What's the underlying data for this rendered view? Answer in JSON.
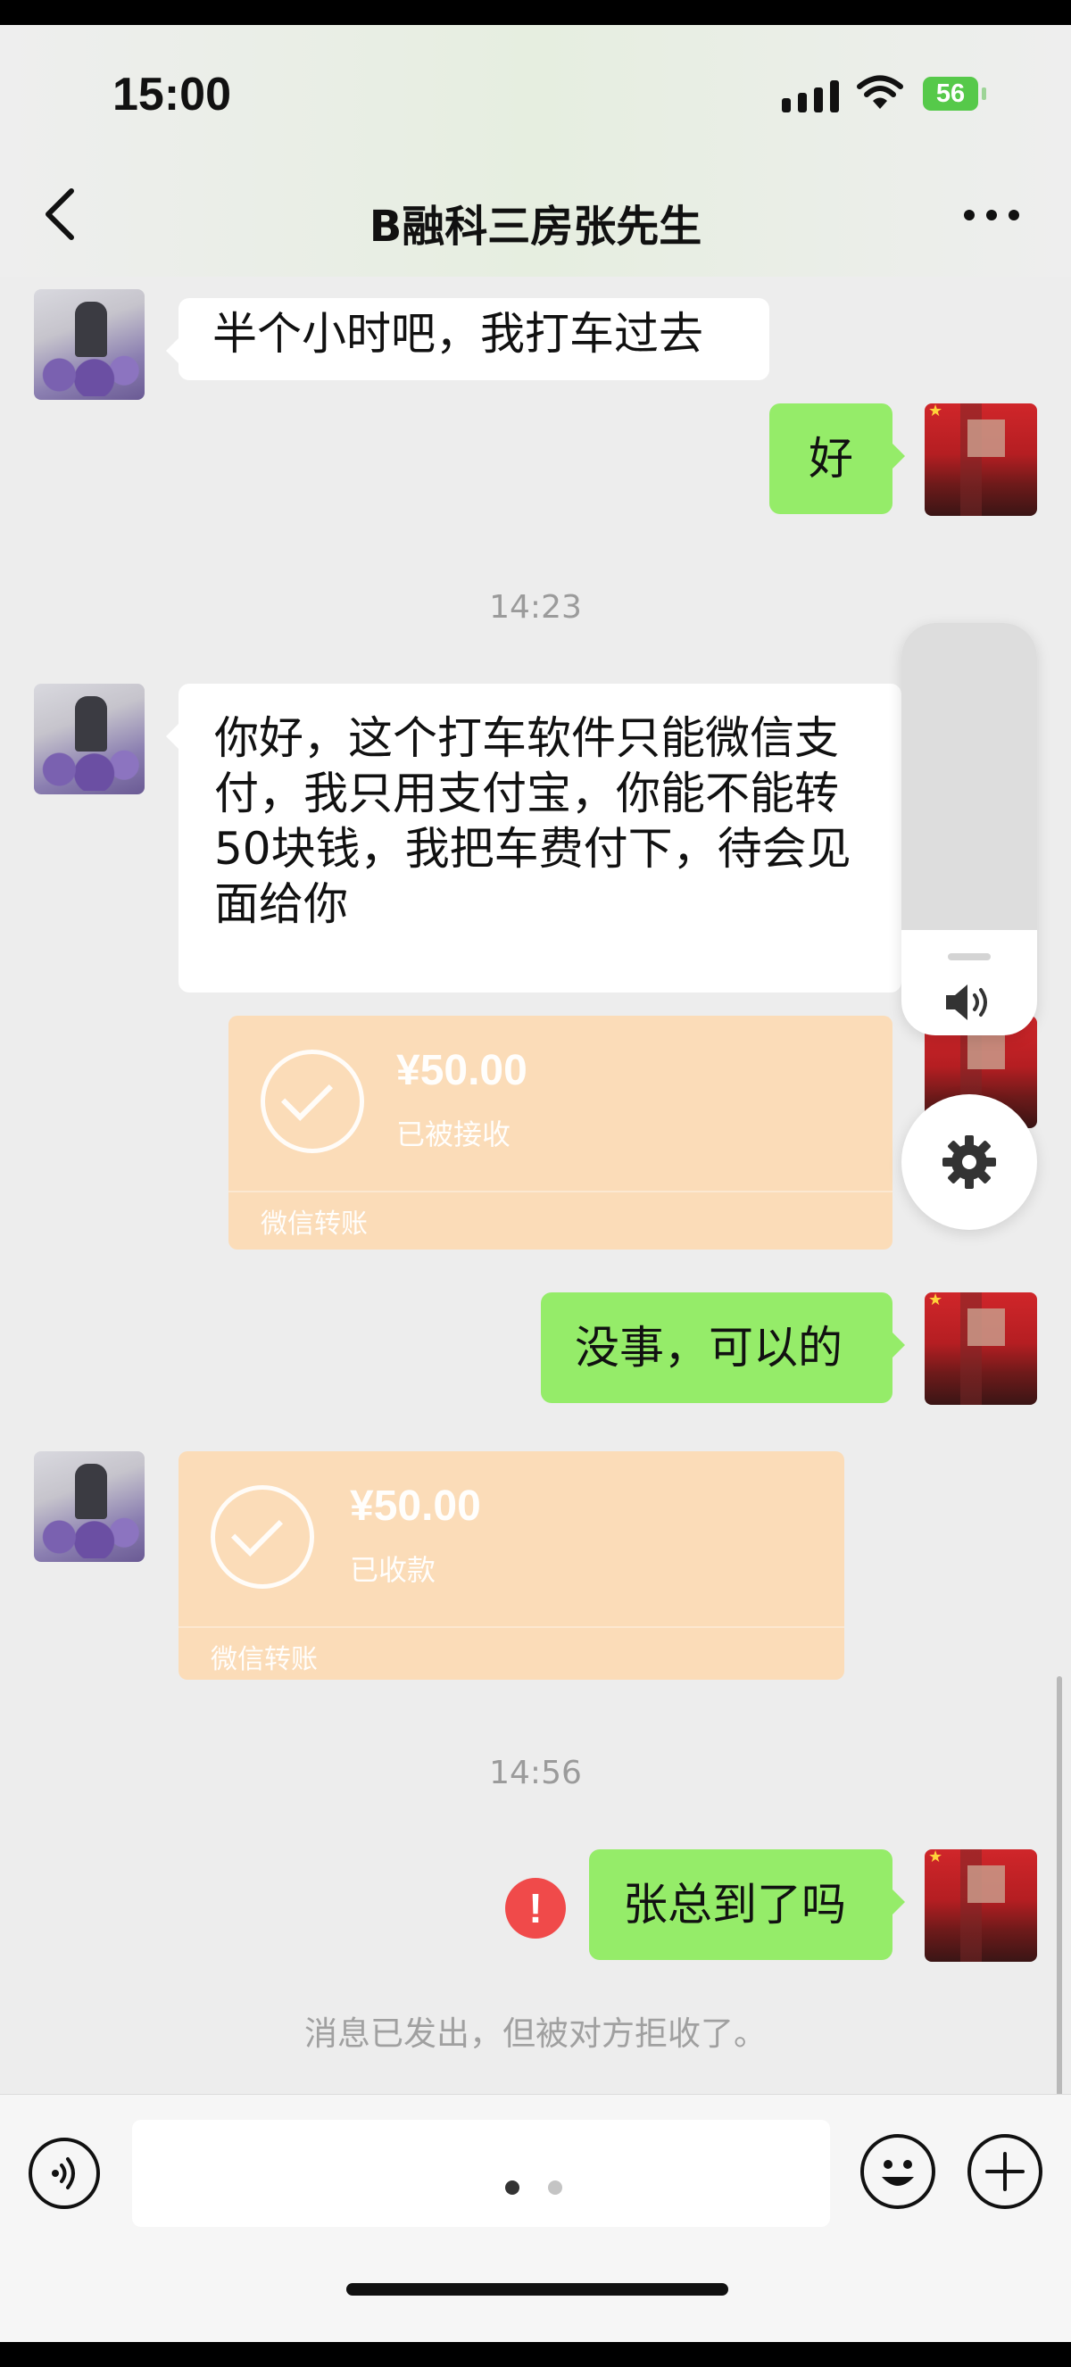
{
  "status_bar": {
    "time": "15:00",
    "battery": "56"
  },
  "header": {
    "title": "B融科三房张先生"
  },
  "messages": {
    "m1": {
      "text": "半个小时吧，我打车过去"
    },
    "m2": {
      "text": "好"
    },
    "ts1": "14:23",
    "m3": {
      "lines": [
        "你好，这个打车软件只能微信支",
        "付，我只用支付宝，你能不能转",
        "50块钱，我把车费付下，待会见",
        "面给你"
      ]
    },
    "transfer1": {
      "amount": "¥50.00",
      "status": "已被接收",
      "footer": "微信转账"
    },
    "m4": {
      "text": "没事，可以的"
    },
    "transfer2": {
      "amount": "¥50.00",
      "status": "已收款",
      "footer": "微信转账"
    },
    "ts2": "14:56",
    "m5": {
      "text": "张总到了吗"
    },
    "error_mark": "!",
    "reject_notice": "消息已发出，但被对方拒收了。"
  },
  "icons": {
    "back": "chevron-left-icon",
    "more": "more-dots-icon",
    "voice": "voice-icon",
    "emoji": "emoji-icon",
    "plus": "plus-icon",
    "speaker": "speaker-icon",
    "gear": "gear-icon",
    "error": "error-icon"
  },
  "colors": {
    "sent_bubble": "#95ec69",
    "received_bubble": "#ffffff",
    "chat_background": "#ededed",
    "transfer_card": "#fbdcb8",
    "error_red": "#f04a4a",
    "battery_green": "#56c94a"
  }
}
